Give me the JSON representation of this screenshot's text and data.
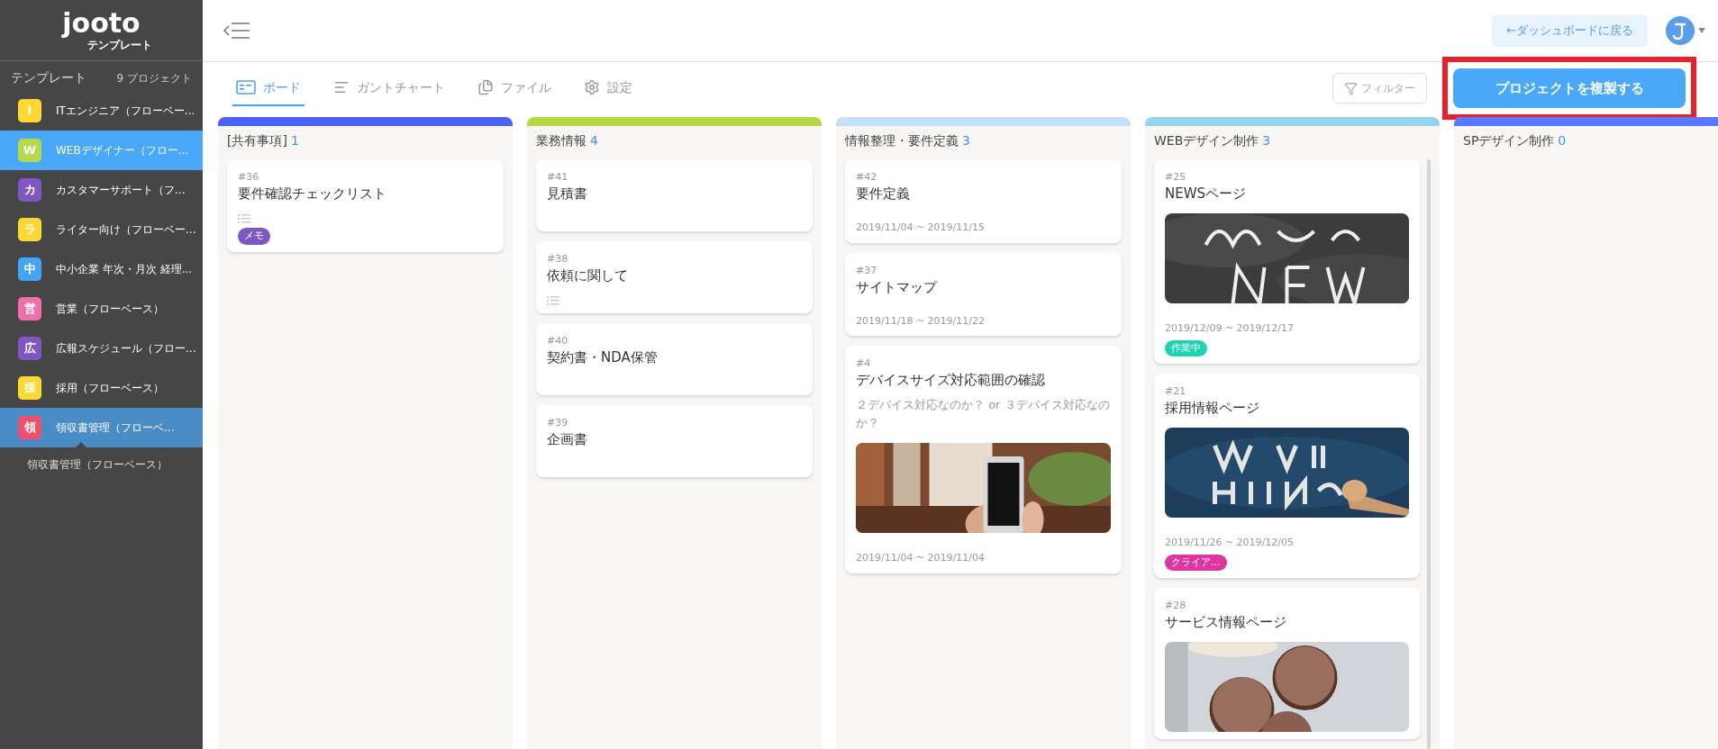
{
  "sidebar": {
    "logo": "jooto",
    "logo_sub": "テンプレート",
    "heading": "テンプレート",
    "count": "9 プロジェクト",
    "items": [
      {
        "badge": "I",
        "label": "ITエンジニア（フローベー...",
        "color": "#fdd835",
        "hovered": false,
        "selected": false
      },
      {
        "badge": "W",
        "label": "WEBデザイナー（フロー...",
        "color": "#b4d94a",
        "hovered": true,
        "selected": false
      },
      {
        "badge": "カ",
        "label": "カスタマーサポート（フ...",
        "color": "#7e57c2",
        "hovered": false,
        "selected": false
      },
      {
        "badge": "ラ",
        "label": "ライター向け（フローベー...",
        "color": "#fdd835",
        "hovered": false,
        "selected": false
      },
      {
        "badge": "中",
        "label": "中小企業 年次・月次 経理...",
        "color": "#42a5f5",
        "hovered": false,
        "selected": false
      },
      {
        "badge": "営",
        "label": "営業（フローベース）",
        "color": "#f06eaa",
        "hovered": false,
        "selected": false
      },
      {
        "badge": "広",
        "label": "広報スケジュール（フロー...",
        "color": "#7e57c2",
        "hovered": false,
        "selected": false
      },
      {
        "badge": "採",
        "label": "採用（フローベース）",
        "color": "#fdd835",
        "hovered": false,
        "selected": false
      },
      {
        "badge": "領",
        "label": "領収書管理（フローベ...",
        "color": "#f0506e",
        "hovered": false,
        "selected": true
      }
    ],
    "tooltip": "領収書管理（フローベース）"
  },
  "header": {
    "back_button": "←ダッシュボードに戻る"
  },
  "tabs": [
    {
      "label": "ボード",
      "selected": true
    },
    {
      "label": "ガントチャート",
      "selected": false
    },
    {
      "label": "ファイル",
      "selected": false
    },
    {
      "label": "設定",
      "selected": false
    }
  ],
  "filter_button": "フィルター",
  "copy_button": {
    "label": "プロジェクトを複製する",
    "highlighted": true
  },
  "columns": [
    {
      "title": "[共有事項]",
      "count": "1",
      "color": "#4a63f0",
      "cards": [
        {
          "number": "#36",
          "title": "要件確認チェックリスト",
          "checklist": true,
          "tags": [
            {
              "label": "メモ",
              "color": "#7e57c2"
            }
          ]
        }
      ]
    },
    {
      "title": "業務情報",
      "count": "4",
      "color": "#b2d943",
      "cards": [
        {
          "number": "#41",
          "title": "見積書",
          "checklist": false
        },
        {
          "number": "#38",
          "title": "依頼に関して",
          "checklist": true
        },
        {
          "number": "#40",
          "title": "契約書・NDA保管",
          "checklist": false
        },
        {
          "number": "#39",
          "title": "企画書",
          "checklist": false
        }
      ]
    },
    {
      "title": "情報整理・要件定義",
      "count": "3",
      "color": "#c5e1f7",
      "cards": [
        {
          "number": "#42",
          "title": "要件定義",
          "checklist": false,
          "dates": "2019/11/04 ~ 2019/11/15"
        },
        {
          "number": "#37",
          "title": "サイトマップ",
          "checklist": false,
          "dates": "2019/11/18 ~ 2019/11/22"
        },
        {
          "number": "#4",
          "title": "デバイスサイズ対応範囲の確認",
          "description": "２デバイス対応なのか？ or ３デバイス対応なのか？",
          "checklist": false,
          "dates": "2019/11/04 ~ 2019/11/04"
        }
      ]
    },
    {
      "title": "WEBデザイン制作",
      "count": "3",
      "color": "#95d5ef",
      "cards": [
        {
          "number": "#25",
          "title": "NEWSページ",
          "checklist": false,
          "dates": "2019/12/09 ~ 2019/12/17",
          "tags": [
            {
              "label": "作業中",
              "color": "#1ed3b0"
            }
          ]
        },
        {
          "number": "#21",
          "title": "採用情報ページ",
          "checklist": false,
          "dates": "2019/11/26 ~ 2019/12/05",
          "tags": [
            {
              "label": "クライア...",
              "color": "#e0359f"
            }
          ]
        },
        {
          "number": "#28",
          "title": "サービス情報ページ",
          "checklist": false
        }
      ]
    },
    {
      "title": "SPデザイン制作",
      "count": "0",
      "color": "#5a78ff"
    }
  ]
}
